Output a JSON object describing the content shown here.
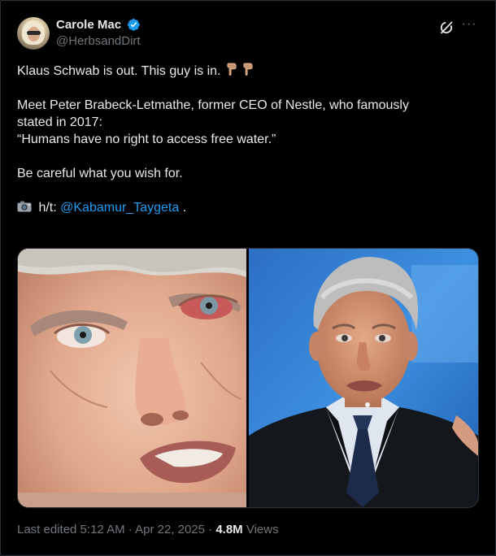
{
  "author": {
    "display_name": "Carole Mac",
    "handle": "@HerbsandDirt",
    "verified": true
  },
  "tweet": {
    "line1": "Klaus Schwab is out. This guy is in.",
    "line2": "Meet Peter Brabeck-Letmathe, former CEO of Nestle, who famously",
    "line3": "stated in 2017:",
    "line4": "“Humans have no right to access free water.”",
    "line5": "Be careful what you wish for.",
    "ht_prefix": "h/t:",
    "mention": "@Kabamur_Taygeta",
    "ht_suffix": "."
  },
  "emojis": {
    "pointing_down_count": 2,
    "pointing_down_icon": "backhand-index-pointing-down-icon",
    "camera_icon": "camera-icon"
  },
  "media": {
    "count": 2
  },
  "footer": {
    "edited_text": "Last edited 5:12 AM · Apr 22, 2025 · ",
    "views_count": "4.8M",
    "views_label": " Views"
  },
  "colors": {
    "background": "#000000",
    "text_primary": "#e7e9ea",
    "text_secondary": "#71767b",
    "link": "#1d9bf0",
    "verified_badge": "#1d9bf0",
    "border": "#2f3336"
  }
}
